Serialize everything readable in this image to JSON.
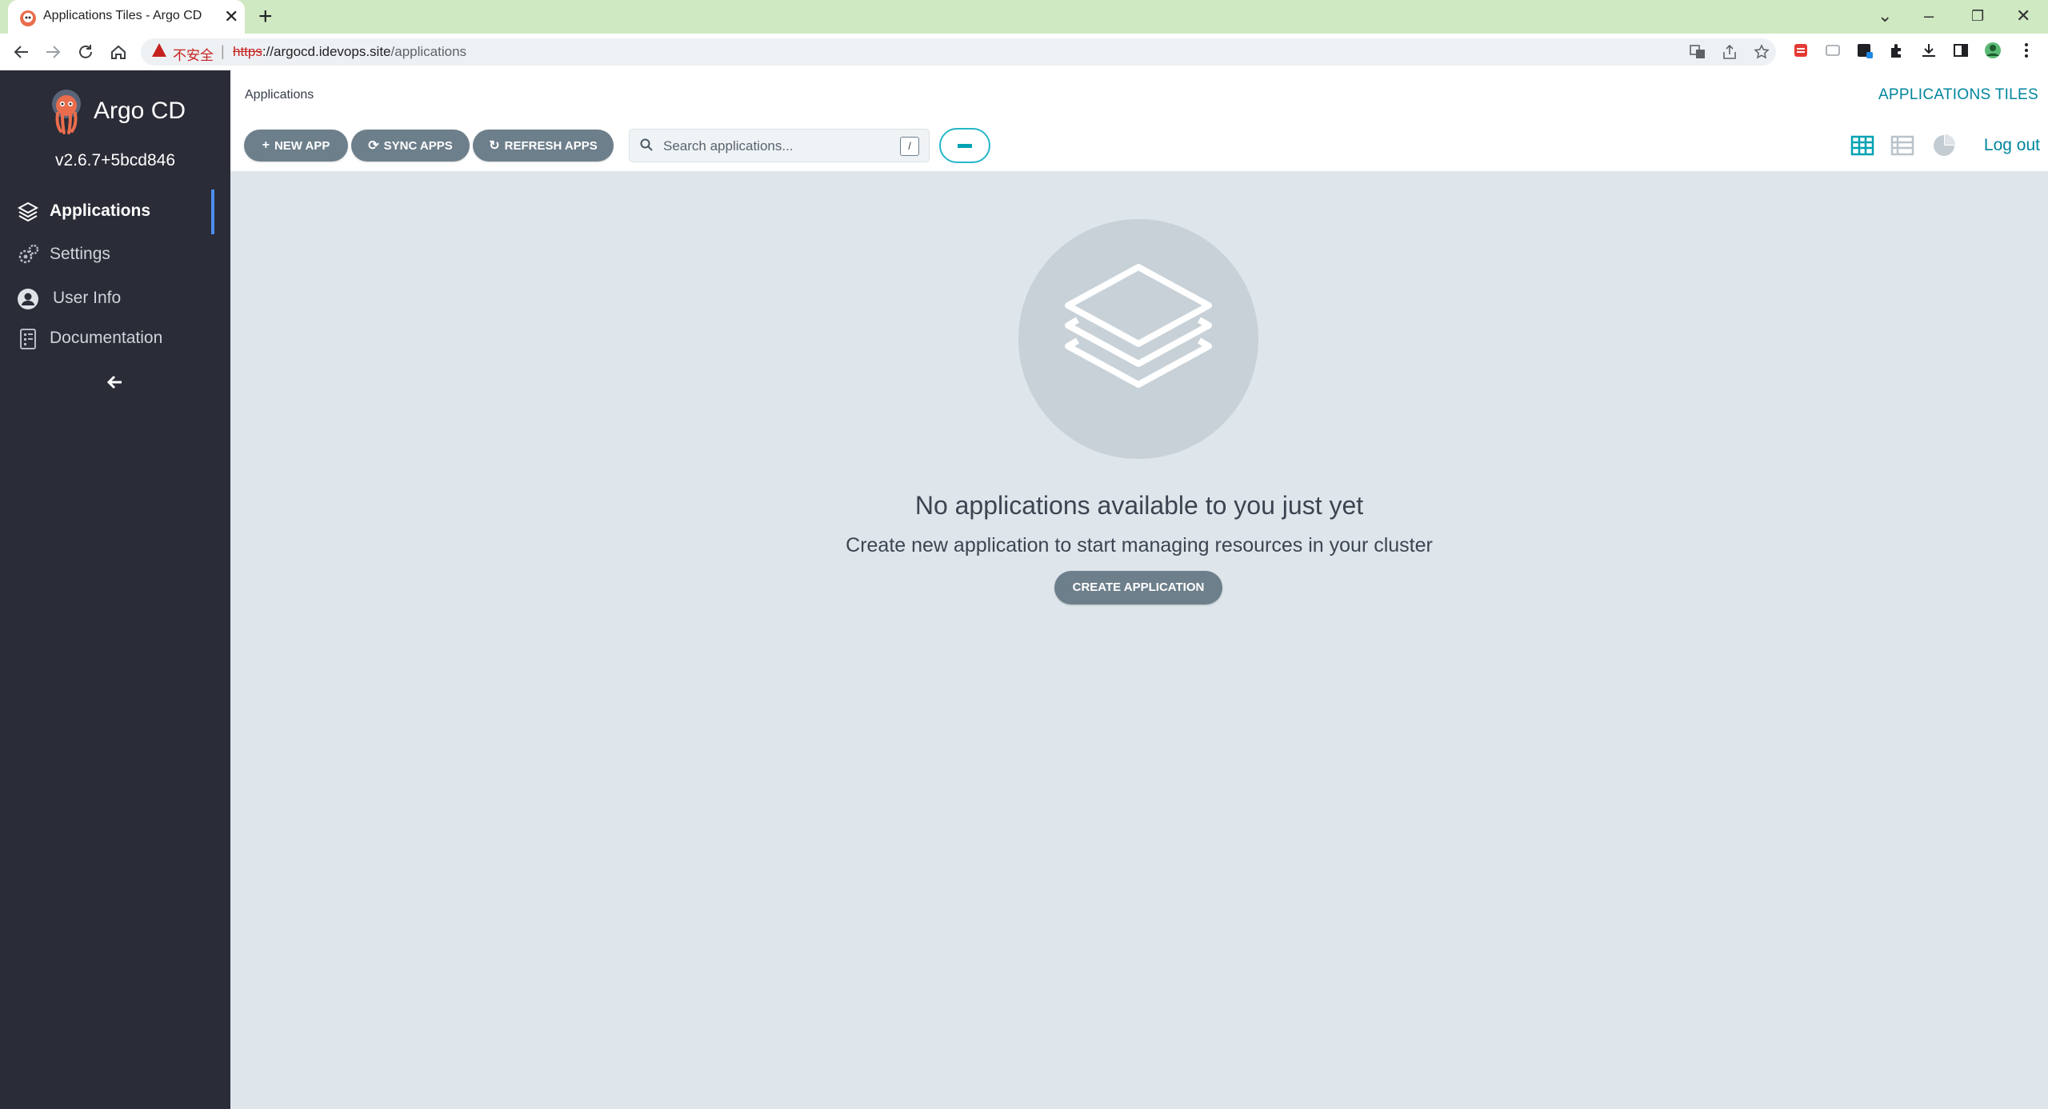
{
  "browser": {
    "tab_title": "Applications Tiles - Argo CD",
    "tab_close": "✕",
    "new_tab": "+",
    "not_secure": "不安全",
    "url_scheme": "https",
    "url_rest_host": "://argocd.idevops.site",
    "url_path": "/applications",
    "window_controls": [
      "⌄",
      "–",
      "❐",
      "✕"
    ]
  },
  "sidebar": {
    "brand": "Argo CD",
    "version": "v2.6.7+5bcd846",
    "items": [
      {
        "label": "Applications",
        "icon": "layers-icon",
        "active": true
      },
      {
        "label": "Settings",
        "icon": "gears-icon",
        "active": false
      },
      {
        "label": "User Info",
        "icon": "user-circle-icon",
        "active": false
      },
      {
        "label": "Documentation",
        "icon": "book-icon",
        "active": false
      }
    ],
    "collapse_icon": "arrow-left-icon"
  },
  "header": {
    "breadcrumb": "Applications",
    "page_title": "APPLICATIONS TILES"
  },
  "toolbar": {
    "new_app": "NEW APP",
    "sync_apps": "SYNC APPS",
    "refresh_apps": "REFRESH APPS",
    "search_placeholder": "Search applications...",
    "search_shortcut": "/",
    "views": [
      "tiles-view-icon",
      "list-view-icon",
      "summary-pie-icon"
    ],
    "logout": "Log out"
  },
  "empty_state": {
    "title": "No applications available to you just yet",
    "subtitle": "Create new application to start managing resources in your cluster",
    "button": "CREATE APPLICATION"
  },
  "colors": {
    "sidebar_bg": "#2a2c37",
    "accent_teal": "#00859d",
    "pill_button": "#6d7f8b",
    "content_bg": "#dee6eb",
    "active_indicator": "#4d8ef0"
  }
}
